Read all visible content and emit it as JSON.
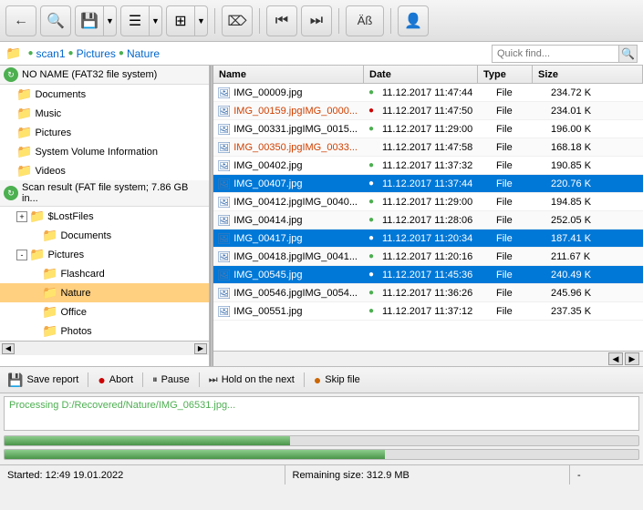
{
  "toolbar": {
    "buttons": [
      {
        "name": "back-button",
        "icon": "←",
        "has_arrow": false
      },
      {
        "name": "search-button",
        "icon": "🔍",
        "has_arrow": false
      },
      {
        "name": "save-button",
        "icon": "💾",
        "has_arrow": true
      },
      {
        "name": "list-button",
        "icon": "☰",
        "has_arrow": true
      },
      {
        "name": "view-button",
        "icon": "⊞",
        "has_arrow": true
      },
      {
        "name": "binoculars-button",
        "icon": "🔭",
        "has_arrow": false
      },
      {
        "name": "prev-button",
        "icon": "⏮",
        "has_arrow": false
      },
      {
        "name": "next-button",
        "icon": "⏭",
        "has_arrow": false
      },
      {
        "name": "text-button",
        "icon": "Äß",
        "has_arrow": false
      },
      {
        "name": "user-button",
        "icon": "👤",
        "has_arrow": false
      }
    ]
  },
  "breadcrumb": {
    "items": [
      "scan1",
      "Pictures",
      "Nature"
    ],
    "search_placeholder": "Quick find..."
  },
  "tree": {
    "items": [
      {
        "id": "no-name-drive",
        "label": "NO NAME (FAT32 file system)",
        "indent": 0,
        "type": "drive",
        "icon": "📁"
      },
      {
        "id": "documents",
        "label": "Documents",
        "indent": 1,
        "type": "folder",
        "icon": "📁"
      },
      {
        "id": "music",
        "label": "Music",
        "indent": 1,
        "type": "folder",
        "icon": "📁"
      },
      {
        "id": "pictures",
        "label": "Pictures",
        "indent": 1,
        "type": "folder",
        "icon": "📁"
      },
      {
        "id": "system-volume",
        "label": "System Volume Information",
        "indent": 1,
        "type": "folder",
        "icon": "📁"
      },
      {
        "id": "videos",
        "label": "Videos",
        "indent": 1,
        "type": "folder",
        "icon": "📁"
      },
      {
        "id": "scan-result",
        "label": "Scan result (FAT file system; 7.86 GB in...",
        "indent": 0,
        "type": "scan",
        "icon": "🔄"
      },
      {
        "id": "lost-files",
        "label": "$LostFiles",
        "indent": 1,
        "type": "folder-expand",
        "icon": "📁"
      },
      {
        "id": "documents2",
        "label": "Documents",
        "indent": 2,
        "type": "folder",
        "icon": "📁"
      },
      {
        "id": "pictures2",
        "label": "Pictures",
        "indent": 1,
        "type": "folder-expanded",
        "icon": "📁"
      },
      {
        "id": "flashcard",
        "label": "Flashcard",
        "indent": 2,
        "type": "folder",
        "icon": "📁"
      },
      {
        "id": "nature",
        "label": "Nature",
        "indent": 2,
        "type": "folder-selected",
        "icon": "📁"
      },
      {
        "id": "office",
        "label": "Office",
        "indent": 2,
        "type": "folder",
        "icon": "📁"
      },
      {
        "id": "photos",
        "label": "Photos",
        "indent": 2,
        "type": "folder",
        "icon": "📁"
      }
    ]
  },
  "files": {
    "headers": [
      "Name",
      "Date",
      "Type",
      "Size"
    ],
    "rows": [
      {
        "name": "IMG_00009.jpg",
        "dot": true,
        "dot_color": "green",
        "date": "11.12.2017 11:47:44",
        "type": "File",
        "size": "234.72 K",
        "orange": false,
        "selected": false
      },
      {
        "name": "IMG_00159.jpgIMG_0000...",
        "dot": true,
        "dot_color": "red",
        "date": "11.12.2017 11:47:50",
        "type": "File",
        "size": "234.01 K",
        "orange": true,
        "selected": false
      },
      {
        "name": "IMG_00331.jpgIMG_0015...",
        "dot": true,
        "dot_color": "green",
        "date": "11.12.2017 11:29:00",
        "type": "File",
        "size": "196.00 K",
        "orange": false,
        "selected": false
      },
      {
        "name": "IMG_00350.jpgIMG_0033...",
        "dot": false,
        "dot_color": "",
        "date": "11.12.2017 11:47:58",
        "type": "File",
        "size": "168.18 K",
        "orange": false,
        "selected": false
      },
      {
        "name": "IMG_00402.jpg",
        "dot": true,
        "dot_color": "green",
        "date": "11.12.2017 11:37:32",
        "type": "File",
        "size": "190.85 K",
        "orange": false,
        "selected": false
      },
      {
        "name": "IMG_00407.jpg",
        "dot": true,
        "dot_color": "green",
        "date": "11.12.2017 11:37:44",
        "type": "File",
        "size": "220.76 K",
        "orange": false,
        "selected": true
      },
      {
        "name": "IMG_00412.jpgIMG_0040...",
        "dot": true,
        "dot_color": "green",
        "date": "11.12.2017 11:29:00",
        "type": "File",
        "size": "194.85 K",
        "orange": false,
        "selected": false
      },
      {
        "name": "IMG_00414.jpg",
        "dot": true,
        "dot_color": "green",
        "date": "11.12.2017 11:28:06",
        "type": "File",
        "size": "252.05 K",
        "orange": false,
        "selected": false
      },
      {
        "name": "IMG_00417.jpg",
        "dot": true,
        "dot_color": "green",
        "date": "11.12.2017 11:20:34",
        "type": "File",
        "size": "187.41 K",
        "orange": false,
        "selected": true
      },
      {
        "name": "IMG_00418.jpgIMG_0041...",
        "dot": true,
        "dot_color": "green",
        "date": "11.12.2017 11:20:16",
        "type": "File",
        "size": "211.67 K",
        "orange": false,
        "selected": false
      },
      {
        "name": "IMG_00545.jpg",
        "dot": true,
        "dot_color": "green",
        "date": "11.12.2017 11:45:36",
        "type": "File",
        "size": "240.49 K",
        "orange": false,
        "selected": true
      },
      {
        "name": "IMG_00546.jpgIMG_0054...",
        "dot": true,
        "dot_color": "green",
        "date": "11.12.2017 11:36:26",
        "type": "File",
        "size": "245.96 K",
        "orange": false,
        "selected": false
      },
      {
        "name": "IMG_00551.jpg",
        "dot": true,
        "dot_color": "green",
        "date": "11.12.2017 11:37:12",
        "type": "File",
        "size": "237.35 K",
        "orange": false,
        "selected": false
      }
    ]
  },
  "bottom_toolbar": {
    "save_label": "Save report",
    "abort_label": "Abort",
    "pause_label": "Pause",
    "hold_label": "Hold on the next",
    "skip_label": "Skip file"
  },
  "log": {
    "processing_text": "Processing D:/Recovered/Nature/IMG_06531.jpg..."
  },
  "progress": {
    "bar1_percent": 45,
    "bar2_percent": 60
  },
  "status": {
    "started": "Started: 12:49 19.01.2022",
    "remaining": "Remaining size: 312.9 MB",
    "dash": "-"
  }
}
